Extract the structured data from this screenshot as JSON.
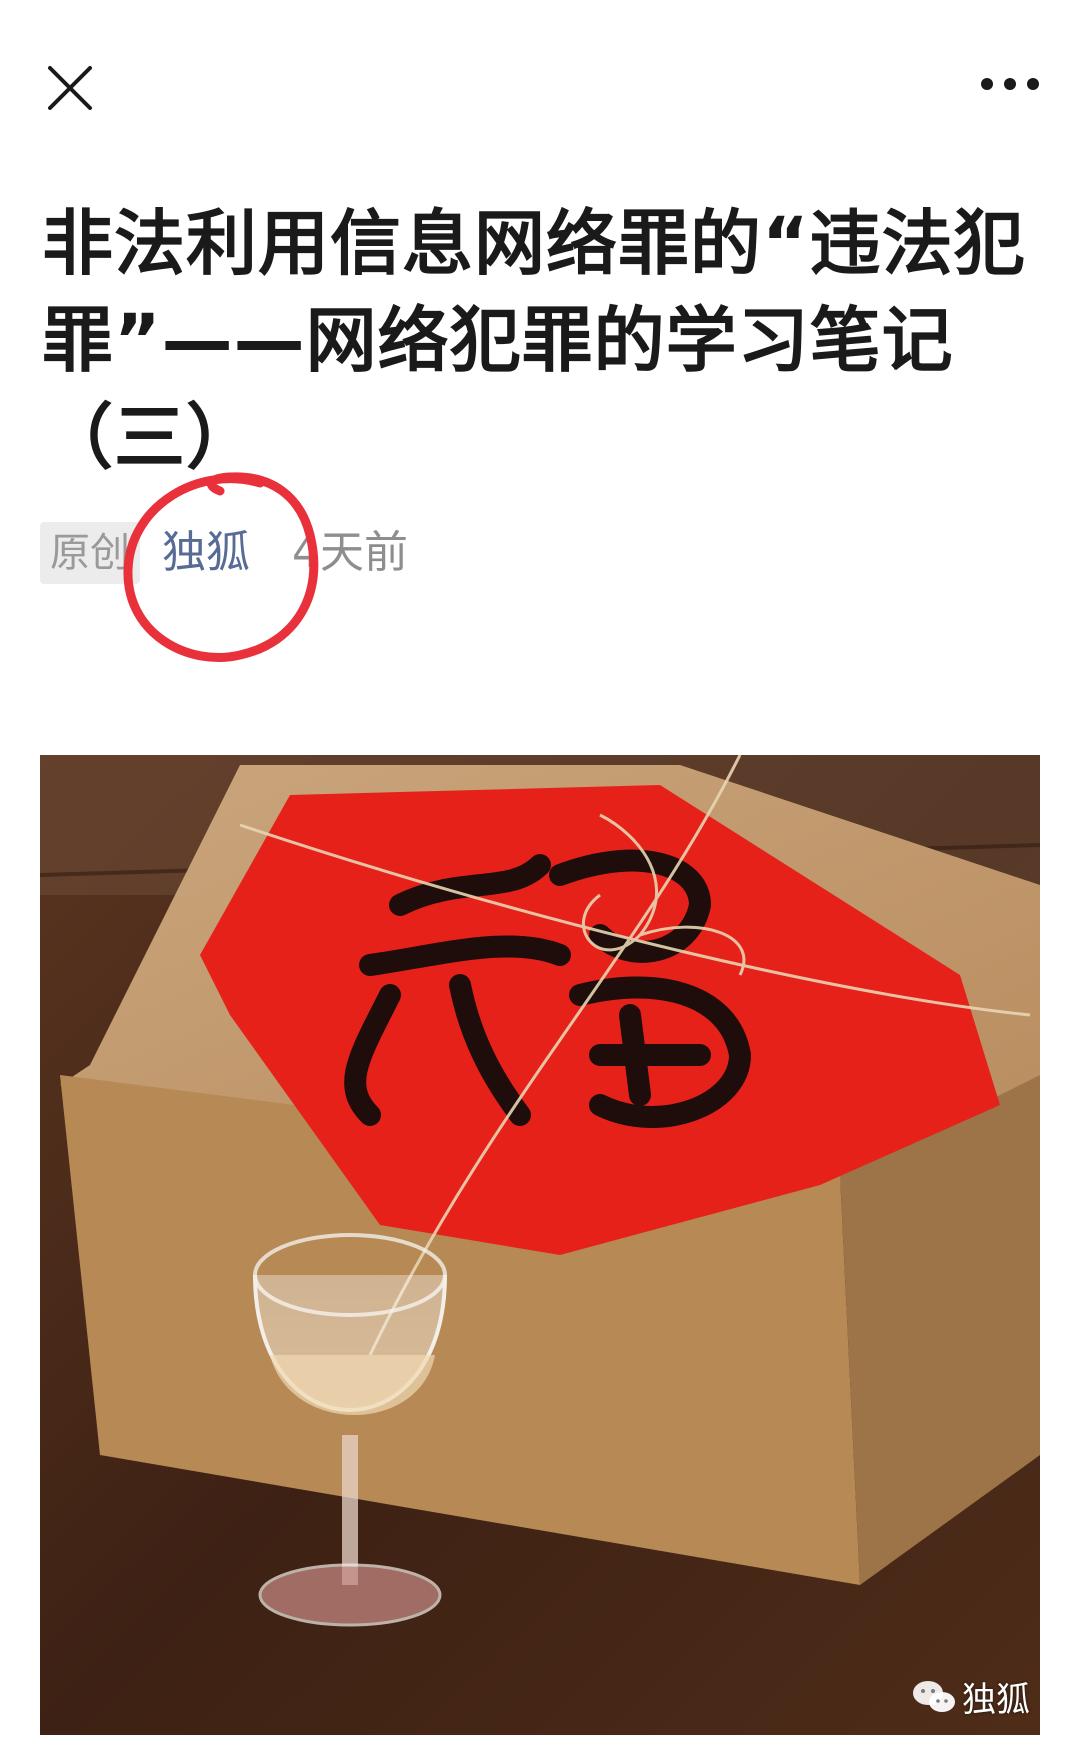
{
  "topbar": {
    "close_icon": "close-icon",
    "more_icon": "more-dots-icon"
  },
  "article": {
    "title": "非法利用信息网络罪的“违法犯罪”——网络犯罪的学习笔记（三）",
    "original_badge": "原创",
    "author": "独狐",
    "time": "4天前"
  },
  "image": {
    "subject": "box-with-fu-character",
    "watermark_text": "独狐",
    "watermark_icon": "wechat-icon"
  },
  "colors": {
    "author_link": "#576b95",
    "annotation_circle": "#e8313a",
    "red_paper": "#e6211a"
  }
}
